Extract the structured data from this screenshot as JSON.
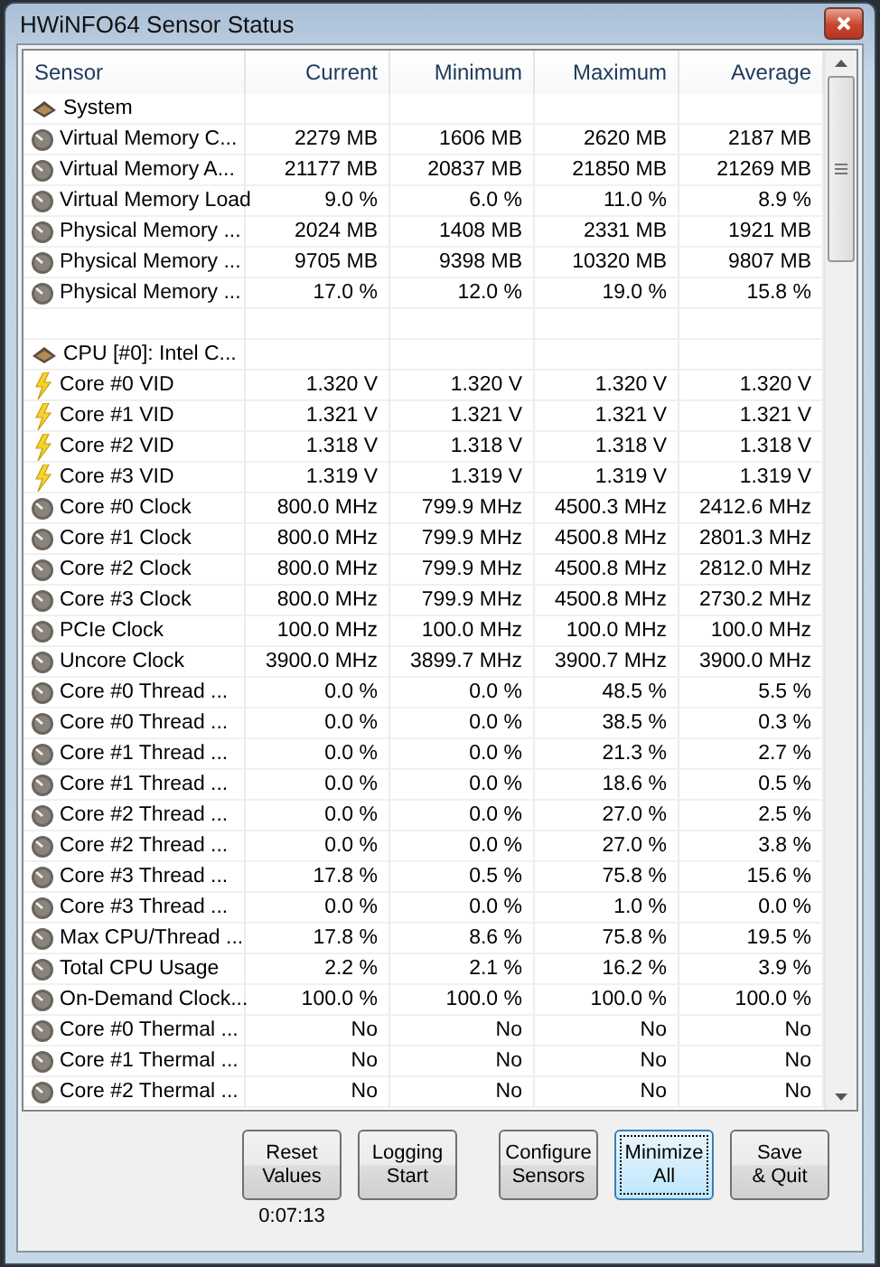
{
  "window": {
    "title": "HWiNFO64 Sensor Status"
  },
  "table": {
    "columns": [
      "Sensor",
      "Current",
      "Minimum",
      "Maximum",
      "Average"
    ],
    "rows": [
      {
        "kind": "group",
        "sensor": "System"
      },
      {
        "kind": "gauge",
        "sensor": "Virtual Memory C...",
        "current": "2279 MB",
        "minimum": "1606 MB",
        "maximum": "2620 MB",
        "average": "2187 MB"
      },
      {
        "kind": "gauge",
        "sensor": "Virtual Memory A...",
        "current": "21177 MB",
        "minimum": "20837 MB",
        "maximum": "21850 MB",
        "average": "21269 MB"
      },
      {
        "kind": "gauge",
        "sensor": "Virtual Memory Load",
        "current": "9.0 %",
        "minimum": "6.0 %",
        "maximum": "11.0 %",
        "average": "8.9 %"
      },
      {
        "kind": "gauge",
        "sensor": "Physical Memory ...",
        "current": "2024 MB",
        "minimum": "1408 MB",
        "maximum": "2331 MB",
        "average": "1921 MB"
      },
      {
        "kind": "gauge",
        "sensor": "Physical Memory ...",
        "current": "9705 MB",
        "minimum": "9398 MB",
        "maximum": "10320 MB",
        "average": "9807 MB"
      },
      {
        "kind": "gauge",
        "sensor": "Physical Memory ...",
        "current": "17.0 %",
        "minimum": "12.0 %",
        "maximum": "19.0 %",
        "average": "15.8 %"
      },
      {
        "kind": "blank"
      },
      {
        "kind": "group",
        "sensor": "CPU [#0]: Intel C..."
      },
      {
        "kind": "voltage",
        "sensor": "Core #0 VID",
        "current": "1.320 V",
        "minimum": "1.320 V",
        "maximum": "1.320 V",
        "average": "1.320 V"
      },
      {
        "kind": "voltage",
        "sensor": "Core #1 VID",
        "current": "1.321 V",
        "minimum": "1.321 V",
        "maximum": "1.321 V",
        "average": "1.321 V"
      },
      {
        "kind": "voltage",
        "sensor": "Core #2 VID",
        "current": "1.318 V",
        "minimum": "1.318 V",
        "maximum": "1.318 V",
        "average": "1.318 V"
      },
      {
        "kind": "voltage",
        "sensor": "Core #3 VID",
        "current": "1.319 V",
        "minimum": "1.319 V",
        "maximum": "1.319 V",
        "average": "1.319 V"
      },
      {
        "kind": "gauge",
        "sensor": "Core #0 Clock",
        "current": "800.0 MHz",
        "minimum": "799.9 MHz",
        "maximum": "4500.3 MHz",
        "average": "2412.6 MHz"
      },
      {
        "kind": "gauge",
        "sensor": "Core #1 Clock",
        "current": "800.0 MHz",
        "minimum": "799.9 MHz",
        "maximum": "4500.8 MHz",
        "average": "2801.3 MHz"
      },
      {
        "kind": "gauge",
        "sensor": "Core #2 Clock",
        "current": "800.0 MHz",
        "minimum": "799.9 MHz",
        "maximum": "4500.8 MHz",
        "average": "2812.0 MHz"
      },
      {
        "kind": "gauge",
        "sensor": "Core #3 Clock",
        "current": "800.0 MHz",
        "minimum": "799.9 MHz",
        "maximum": "4500.8 MHz",
        "average": "2730.2 MHz"
      },
      {
        "kind": "gauge",
        "sensor": "PCIe Clock",
        "current": "100.0 MHz",
        "minimum": "100.0 MHz",
        "maximum": "100.0 MHz",
        "average": "100.0 MHz"
      },
      {
        "kind": "gauge",
        "sensor": "Uncore Clock",
        "current": "3900.0 MHz",
        "minimum": "3899.7 MHz",
        "maximum": "3900.7 MHz",
        "average": "3900.0 MHz"
      },
      {
        "kind": "gauge",
        "sensor": "Core #0 Thread ...",
        "current": "0.0 %",
        "minimum": "0.0 %",
        "maximum": "48.5 %",
        "average": "5.5 %"
      },
      {
        "kind": "gauge",
        "sensor": "Core #0 Thread ...",
        "current": "0.0 %",
        "minimum": "0.0 %",
        "maximum": "38.5 %",
        "average": "0.3 %"
      },
      {
        "kind": "gauge",
        "sensor": "Core #1 Thread ...",
        "current": "0.0 %",
        "minimum": "0.0 %",
        "maximum": "21.3 %",
        "average": "2.7 %"
      },
      {
        "kind": "gauge",
        "sensor": "Core #1 Thread ...",
        "current": "0.0 %",
        "minimum": "0.0 %",
        "maximum": "18.6 %",
        "average": "0.5 %"
      },
      {
        "kind": "gauge",
        "sensor": "Core #2 Thread ...",
        "current": "0.0 %",
        "minimum": "0.0 %",
        "maximum": "27.0 %",
        "average": "2.5 %"
      },
      {
        "kind": "gauge",
        "sensor": "Core #2 Thread ...",
        "current": "0.0 %",
        "minimum": "0.0 %",
        "maximum": "27.0 %",
        "average": "3.8 %"
      },
      {
        "kind": "gauge",
        "sensor": "Core #3 Thread ...",
        "current": "17.8 %",
        "minimum": "0.5 %",
        "maximum": "75.8 %",
        "average": "15.6 %"
      },
      {
        "kind": "gauge",
        "sensor": "Core #3 Thread ...",
        "current": "0.0 %",
        "minimum": "0.0 %",
        "maximum": "1.0 %",
        "average": "0.0 %"
      },
      {
        "kind": "gauge",
        "sensor": "Max CPU/Thread ...",
        "current": "17.8 %",
        "minimum": "8.6 %",
        "maximum": "75.8 %",
        "average": "19.5 %"
      },
      {
        "kind": "gauge",
        "sensor": "Total CPU Usage",
        "current": "2.2 %",
        "minimum": "2.1 %",
        "maximum": "16.2 %",
        "average": "3.9 %"
      },
      {
        "kind": "gauge",
        "sensor": "On-Demand Clock...",
        "current": "100.0 %",
        "minimum": "100.0 %",
        "maximum": "100.0 %",
        "average": "100.0 %"
      },
      {
        "kind": "gauge",
        "sensor": "Core #0 Thermal ...",
        "current": "No",
        "minimum": "No",
        "maximum": "No",
        "average": "No"
      },
      {
        "kind": "gauge",
        "sensor": "Core #1 Thermal ...",
        "current": "No",
        "minimum": "No",
        "maximum": "No",
        "average": "No"
      },
      {
        "kind": "gauge",
        "sensor": "Core #2 Thermal ...",
        "current": "No",
        "minimum": "No",
        "maximum": "No",
        "average": "No"
      }
    ]
  },
  "buttons": [
    {
      "lines": [
        "Reset",
        "Values"
      ],
      "focused": false,
      "caption": "0:07:13"
    },
    {
      "lines": [
        "Logging",
        "Start"
      ],
      "focused": false
    },
    {
      "lines": [
        "Configure",
        "Sensors"
      ],
      "focused": false
    },
    {
      "lines": [
        "Minimize",
        "All"
      ],
      "focused": true
    },
    {
      "lines": [
        "Save",
        "& Quit"
      ],
      "focused": false
    }
  ]
}
